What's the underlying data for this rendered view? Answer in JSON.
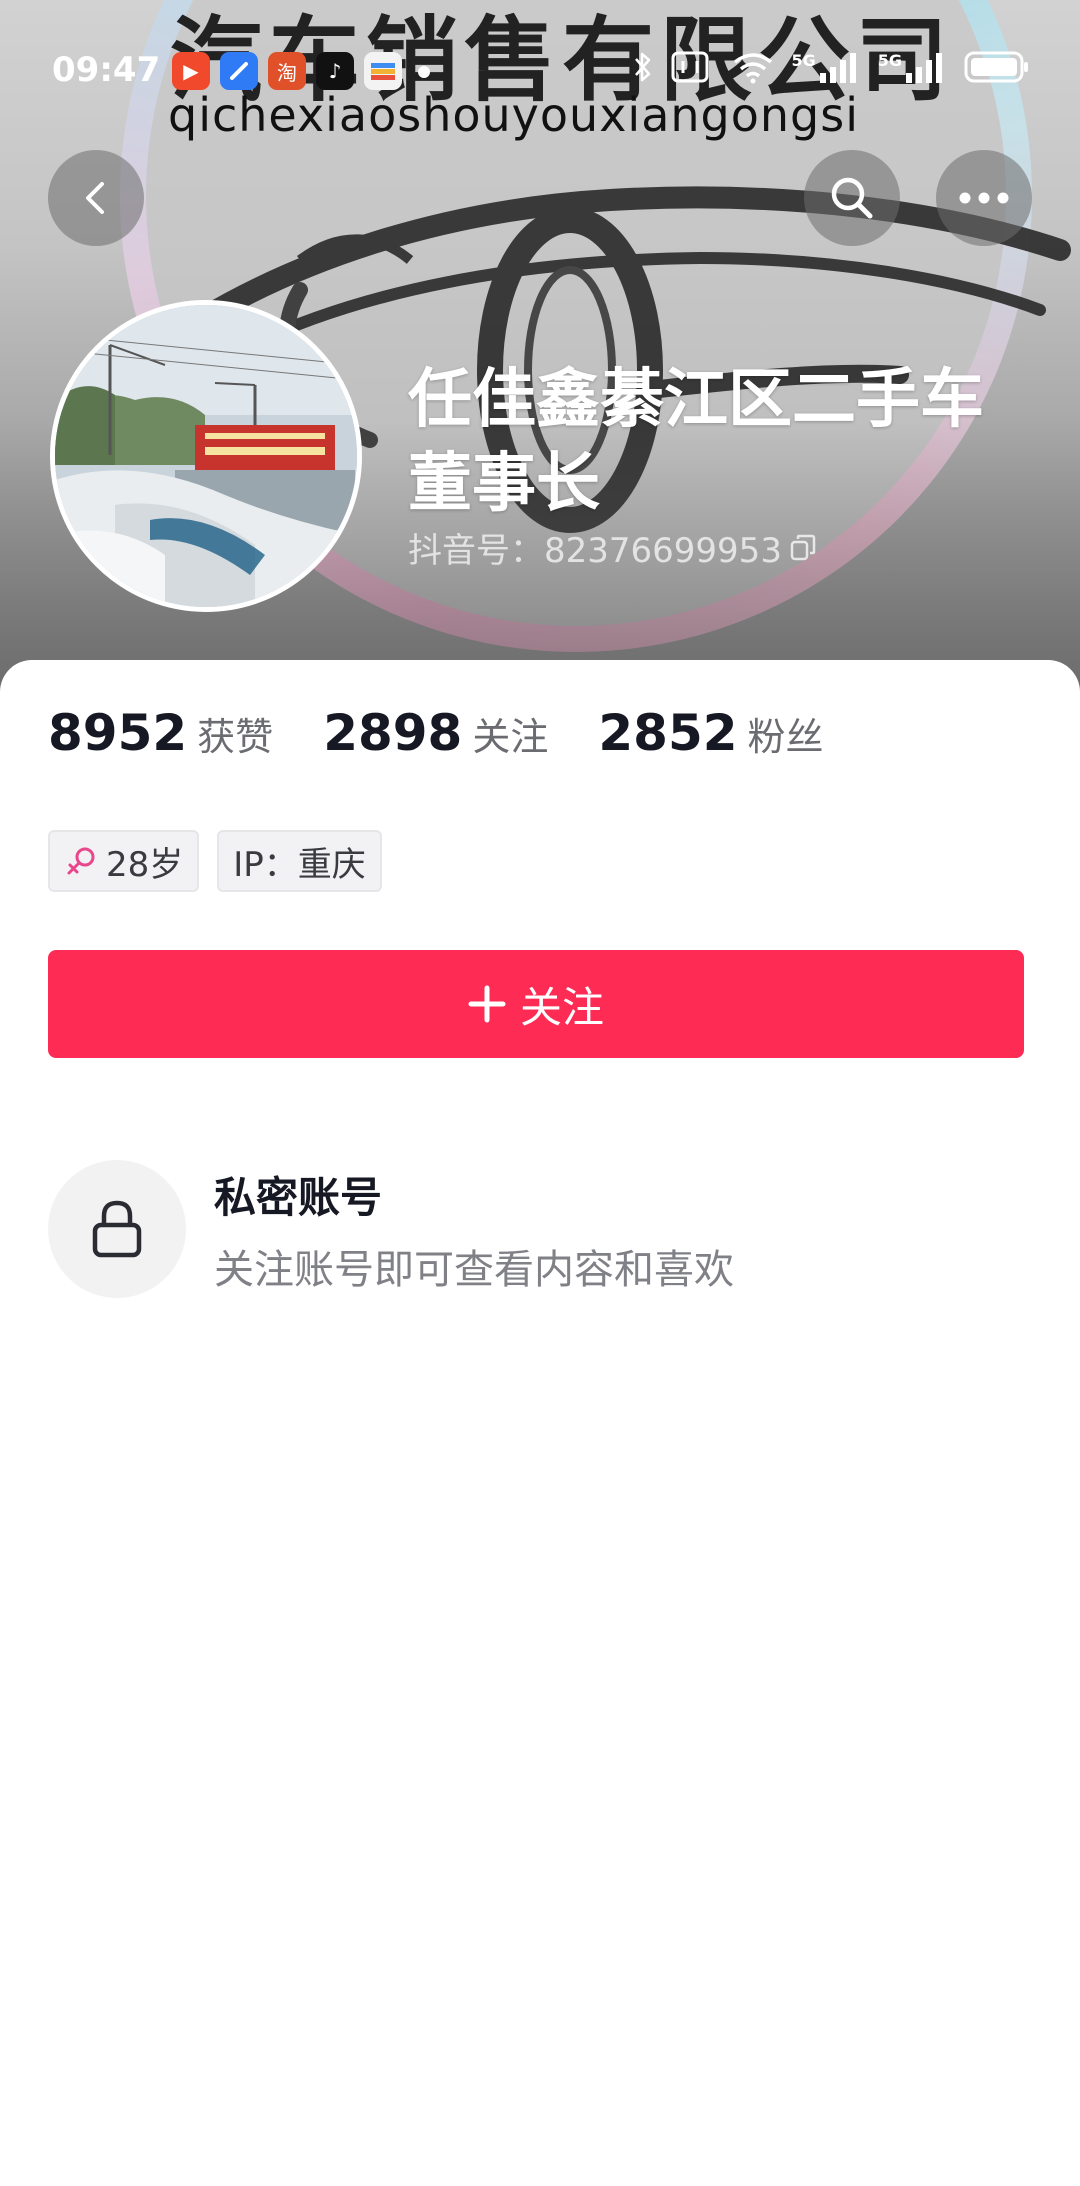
{
  "status_bar": {
    "time": "09:47",
    "apps": [
      "play-app-icon",
      "blue-app-icon",
      "taobao-app-icon",
      "tiktok-app-icon",
      "wallet-app-icon"
    ],
    "taobao_glyph": "淘",
    "network_label_1": "5G",
    "network_label_2": "5G",
    "icons": [
      "bluetooth-icon",
      "nfc-icon",
      "wifi-icon",
      "signal-icon",
      "battery-icon"
    ]
  },
  "banner": {
    "company_title": "汽车销售有限公司",
    "company_pinyin": "qichexiaoshouyouxiangongsi"
  },
  "header": {
    "back_icon": "chevron-left-icon",
    "search_icon": "search-icon",
    "more_icon": "more-dots-icon"
  },
  "profile": {
    "name_line1": "任佳鑫綦江区二手车",
    "name_line2": "董事长",
    "douyin_id": "抖音号：82376699953",
    "copy_icon": "copy-icon"
  },
  "stats": [
    {
      "value": "8952",
      "label": "获赞"
    },
    {
      "value": "2898",
      "label": "关注"
    },
    {
      "value": "2852",
      "label": "粉丝"
    }
  ],
  "tags": {
    "age": "28岁",
    "ip": "IP：重庆",
    "gender_icon": "female-icon",
    "gender_color": "#e8478c"
  },
  "follow_button": {
    "label": "关注",
    "color": "#fe2c55"
  },
  "private_account": {
    "title": "私密账号",
    "description": "关注账号即可查看内容和喜欢"
  }
}
